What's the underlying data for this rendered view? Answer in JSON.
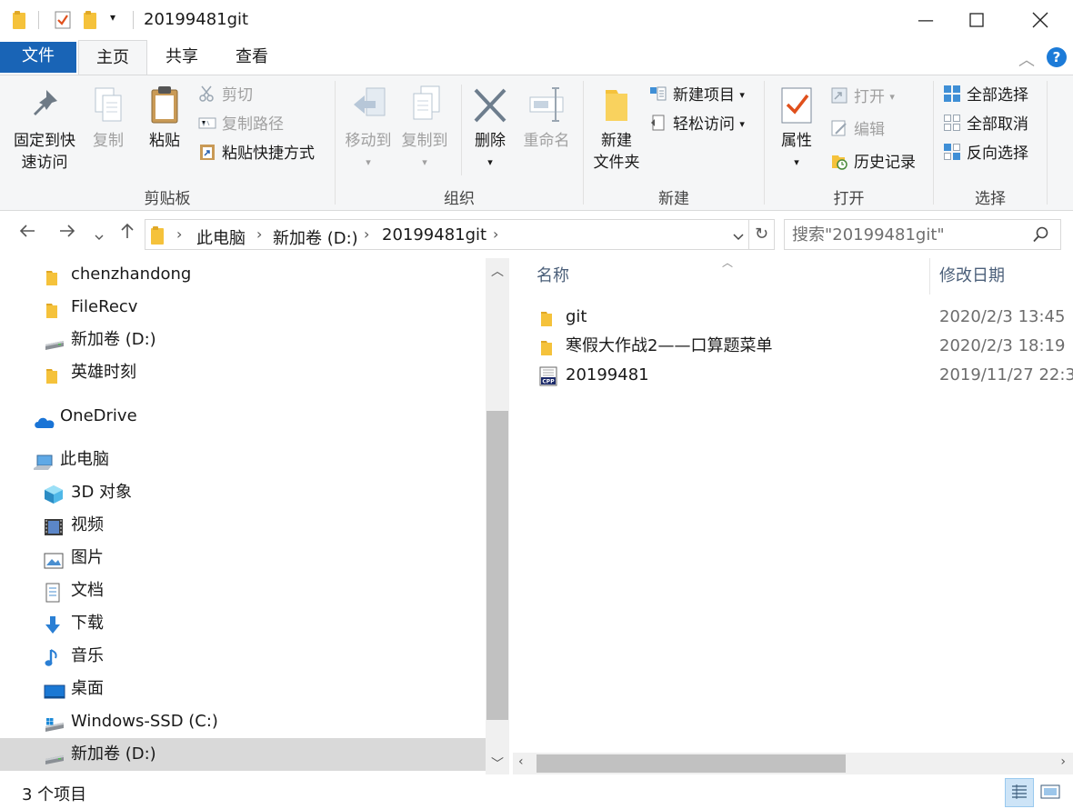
{
  "window": {
    "title": "20199481git",
    "minimize": "—",
    "maximize": "☐",
    "close": "✕"
  },
  "ribbon_tabs": [
    "文件",
    "主页",
    "共享",
    "查看"
  ],
  "ribbon": {
    "clipboard": {
      "label": "剪贴板",
      "pin": [
        "固定到快",
        "速访问"
      ],
      "copy": "复制",
      "paste": "粘贴",
      "cut": "剪切",
      "copy_path": "复制路径",
      "paste_shortcut": "粘贴快捷方式"
    },
    "organize": {
      "label": "组织",
      "move_to": "移动到",
      "copy_to": "复制到",
      "delete": "删除",
      "rename": "重命名"
    },
    "new": {
      "label": "新建",
      "new_folder": [
        "新建",
        "文件夹"
      ],
      "new_item": "新建项目",
      "easy_access": "轻松访问"
    },
    "open": {
      "label": "打开",
      "properties": "属性",
      "open": "打开",
      "edit": "编辑",
      "history": "历史记录"
    },
    "select": {
      "label": "选择",
      "select_all": "全部选择",
      "select_none": "全部取消",
      "invert": "反向选择"
    }
  },
  "address": {
    "crumbs": [
      "此电脑",
      "新加卷 (D:)",
      "20199481git"
    ]
  },
  "search": {
    "placeholder": "搜索\"20199481git\""
  },
  "nav": [
    {
      "label": "chenzhandong",
      "icon": "folder-icon",
      "indent": 1
    },
    {
      "label": "FileRecv",
      "icon": "folder-icon",
      "indent": 1
    },
    {
      "label": "新加卷 (D:)",
      "icon": "drive-icon",
      "indent": 1
    },
    {
      "label": "英雄时刻",
      "icon": "folder-icon",
      "indent": 1
    },
    {
      "label": "OneDrive",
      "icon": "onedrive-icon",
      "indent": 0
    },
    {
      "label": "此电脑",
      "icon": "computer-icon",
      "indent": 0
    },
    {
      "label": "3D 对象",
      "icon": "3d-objects-icon",
      "indent": 1
    },
    {
      "label": "视频",
      "icon": "video-icon",
      "indent": 1
    },
    {
      "label": "图片",
      "icon": "pictures-icon",
      "indent": 1
    },
    {
      "label": "文档",
      "icon": "documents-icon",
      "indent": 1
    },
    {
      "label": "下载",
      "icon": "downloads-icon",
      "indent": 1
    },
    {
      "label": "音乐",
      "icon": "music-icon",
      "indent": 1
    },
    {
      "label": "桌面",
      "icon": "desktop-icon",
      "indent": 1
    },
    {
      "label": "Windows-SSD (C:)",
      "icon": "drive-c-icon",
      "indent": 1
    },
    {
      "label": "新加卷 (D:)",
      "icon": "drive-icon",
      "indent": 1,
      "selected": true
    }
  ],
  "filelist": {
    "columns": [
      "名称",
      "修改日期"
    ],
    "rows": [
      {
        "name": "git",
        "date": "2020/2/3 13:45",
        "icon": "folder-icon"
      },
      {
        "name": "寒假大作战2——口算题菜单",
        "date": "2020/2/3 18:19",
        "icon": "folder-icon"
      },
      {
        "name": "20199481",
        "date": "2019/11/27 22:3",
        "icon": "cpp-file-icon"
      }
    ]
  },
  "status": {
    "count": "3 个项目"
  },
  "colors": {
    "file_tab": "#1964b6",
    "folder": "#f5c23b",
    "selection": "#d9d9d9"
  }
}
